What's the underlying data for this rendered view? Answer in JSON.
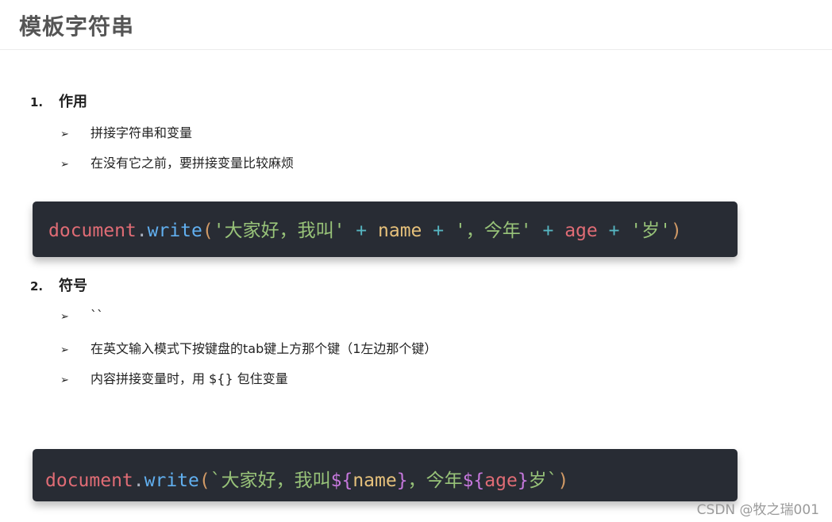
{
  "header": {
    "title": "模板字符串"
  },
  "section1": {
    "number": "1.",
    "title": "作用",
    "bullets": [
      "拼接字符串和变量",
      "在没有它之前，要拼接变量比较麻烦"
    ]
  },
  "code1": {
    "obj": "document",
    "dot": ".",
    "fn": "write",
    "open": "(",
    "s1": "'大家好，我叫'",
    "op1": " + ",
    "var1": "name",
    "op2": " + ",
    "s2": "'，今年'",
    "op3": " + ",
    "var2": "age",
    "op4": " + ",
    "s3": "'岁'",
    "close": ")"
  },
  "section2": {
    "number": "2.",
    "title": "符号",
    "bullets": [
      "``",
      "在英文输入模式下按键盘的tab键上方那个键（1左边那个键）",
      "内容拼接变量时，用 ${} 包住变量"
    ]
  },
  "code2": {
    "obj": "document",
    "dot": ".",
    "fn": "write",
    "open": "(",
    "s1": "`大家好，我叫",
    "t1open": "${",
    "var1": "name",
    "t1close": "}",
    "s2": "，今年",
    "t2open": "${",
    "var2": "age",
    "t2close": "}",
    "s3": "岁`",
    "close": ")"
  },
  "bullet_glyph": "➢",
  "watermark": "CSDN @牧之瑞001",
  "colors": {
    "code_bg": "#282c34",
    "object": "#e06c75",
    "function": "#61afef",
    "string": "#98c379",
    "operator": "#56b6c2",
    "variable": "#e5c07b",
    "template": "#c678dd"
  }
}
